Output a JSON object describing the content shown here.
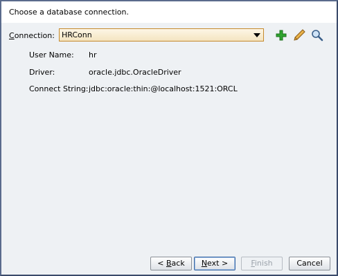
{
  "header": {
    "instruction": "Choose a database connection."
  },
  "connection": {
    "label_mnemonic": "C",
    "label_rest": "onnection:",
    "selected_value": "HRConn",
    "icons": [
      "add-icon",
      "edit-icon",
      "browse-icon"
    ]
  },
  "details": [
    {
      "label": "User Name:",
      "value": "hr"
    },
    {
      "label": "Driver:",
      "value": "oracle.jdbc.OracleDriver"
    },
    {
      "label": "Connect String:",
      "value": "jdbc:oracle:thin:@localhost:1521:ORCL"
    }
  ],
  "buttons": {
    "back": {
      "prefix": "< ",
      "mnemonic": "B",
      "rest": "ack"
    },
    "next": {
      "mnemonic": "N",
      "rest": "ext >"
    },
    "finish": {
      "mnemonic": "F",
      "rest": "inish"
    },
    "cancel": {
      "label": "Cancel"
    }
  },
  "colors": {
    "panel_background": "#eef1f4",
    "combo_border": "#c58a2c",
    "add_icon": "#2fa52f",
    "edit_icon": "#d9a441"
  }
}
